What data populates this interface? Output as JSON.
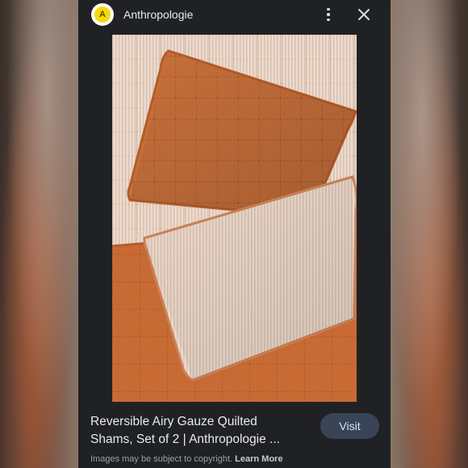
{
  "header": {
    "favicon_letter": "A",
    "site_name": "Anthropologie",
    "more_icon": "more-vert-icon",
    "close_icon": "close-icon"
  },
  "image": {
    "lens_icon": "lens-icon"
  },
  "result": {
    "title_line1": "Reversible Airy Gauze Quilted",
    "title_line2": "Shams, Set of 2 | Anthropologie ...",
    "visit_label": "Visit"
  },
  "footer": {
    "copyright_text": "Images may be subject to copyright.",
    "learn_more_label": "Learn More"
  },
  "colors": {
    "panel_bg": "#202124",
    "visit_bg": "#394457",
    "orange_fabric": "#c46a35",
    "cream_fabric": "#ead6c7"
  }
}
